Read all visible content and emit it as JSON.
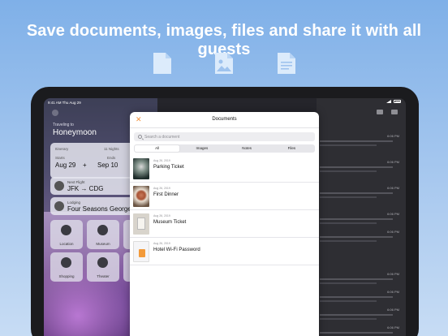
{
  "headline": "Save documents, images, files and share it with all guests",
  "feature_icons": [
    "document-icon",
    "image-file-icon",
    "text-file-icon"
  ],
  "colors": {
    "accent": "#f4913b",
    "background_top": "#7fb0e8",
    "icon_tint": "#dcebfb"
  },
  "status_bar": {
    "time": "9:41 AM  Thu Aug 29"
  },
  "background_app": {
    "trip_subtitle": "Traveling to",
    "trip_title": "Honeymoon",
    "itinerary": {
      "label": "Itinerary",
      "nights": "11 Nights",
      "starts_label": "Starts",
      "ends_label": "Ends",
      "start": "Aug 29",
      "end": "Sep 10"
    },
    "flight": {
      "label": "Next Flight",
      "route": "JFK → CDG"
    },
    "lodging": {
      "label": "Lodging",
      "name": "Four Seasons George"
    },
    "tiles": [
      "Location",
      "Museum",
      "Shopping",
      "Theater"
    ],
    "right_list_times": [
      "6:06 PM",
      "6:06 PM",
      "6:06 PM",
      "6:06 PM",
      "6:06 PM",
      "6:06 PM",
      "6:06 PM",
      "6:06 PM",
      "6:06 PM"
    ]
  },
  "modal": {
    "title": "Documents",
    "search_placeholder": "Search a document",
    "tabs": [
      {
        "label": "All",
        "active": true
      },
      {
        "label": "Images",
        "active": false
      },
      {
        "label": "Notes",
        "active": false
      },
      {
        "label": "Files",
        "active": false
      }
    ],
    "documents": [
      {
        "date": "Aug 26, 2019",
        "name": "Parking Ticket"
      },
      {
        "date": "Aug 26, 2019",
        "name": "First Dinner"
      },
      {
        "date": "Aug 26, 2019",
        "name": "Museum Ticket"
      },
      {
        "date": "Aug 26, 2019",
        "name": "Hotel Wi-Fi Password"
      }
    ]
  }
}
